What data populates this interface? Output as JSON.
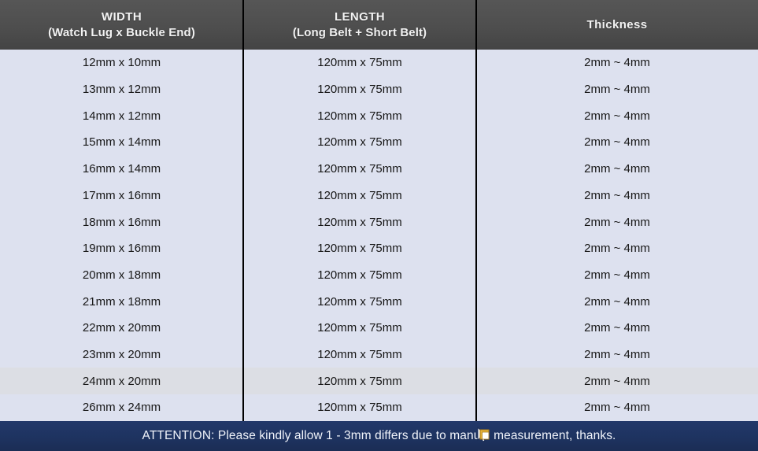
{
  "table": {
    "columns": [
      {
        "key": "width",
        "line1": "WIDTH",
        "line2": "(Watch Lug x Buckle End)"
      },
      {
        "key": "length",
        "line1": "LENGTH",
        "line2": "(Long Belt + Short Belt)"
      },
      {
        "key": "thickness",
        "line1": "Thickness",
        "line2": ""
      }
    ],
    "rows": [
      {
        "width": "12mm x 10mm",
        "length": "120mm x 75mm",
        "thickness": "2mm ~ 4mm",
        "highlighted": false
      },
      {
        "width": "13mm x 12mm",
        "length": "120mm x 75mm",
        "thickness": "2mm ~ 4mm",
        "highlighted": false
      },
      {
        "width": "14mm x 12mm",
        "length": "120mm x 75mm",
        "thickness": "2mm ~ 4mm",
        "highlighted": false
      },
      {
        "width": "15mm x 14mm",
        "length": "120mm x 75mm",
        "thickness": "2mm ~ 4mm",
        "highlighted": false
      },
      {
        "width": "16mm x 14mm",
        "length": "120mm x 75mm",
        "thickness": "2mm ~ 4mm",
        "highlighted": false
      },
      {
        "width": "17mm x 16mm",
        "length": "120mm x 75mm",
        "thickness": "2mm ~ 4mm",
        "highlighted": false
      },
      {
        "width": "18mm x 16mm",
        "length": "120mm x 75mm",
        "thickness": "2mm ~ 4mm",
        "highlighted": false
      },
      {
        "width": "19mm x 16mm",
        "length": "120mm x 75mm",
        "thickness": "2mm ~ 4mm",
        "highlighted": false
      },
      {
        "width": "20mm x 18mm",
        "length": "120mm x 75mm",
        "thickness": "2mm ~ 4mm",
        "highlighted": false
      },
      {
        "width": "21mm x 18mm",
        "length": "120mm x 75mm",
        "thickness": "2mm ~ 4mm",
        "highlighted": false
      },
      {
        "width": "22mm x 20mm",
        "length": "120mm x 75mm",
        "thickness": "2mm ~ 4mm",
        "highlighted": false
      },
      {
        "width": "23mm x 20mm",
        "length": "120mm x 75mm",
        "thickness": "2mm ~ 4mm",
        "highlighted": false
      },
      {
        "width": "24mm x 20mm",
        "length": "120mm x 75mm",
        "thickness": "2mm ~ 4mm",
        "highlighted": true
      },
      {
        "width": "26mm x 24mm",
        "length": "120mm x 75mm",
        "thickness": "2mm ~ 4mm",
        "highlighted": false
      }
    ]
  },
  "footer": {
    "notice": "ATTENTION: Please kindly allow 1 - 3mm differs due to manual measurement, thanks."
  },
  "cursor": {
    "icon": "drag-copy-cursor-icon"
  },
  "colors": {
    "header_bg": "#4e4e4e",
    "header_text": "#f2f2f2",
    "body_bg": "#dde1ef",
    "row_highlight_bg": "#dcdee4",
    "body_text": "#161616",
    "divider": "#000000",
    "footer_bg": "#1e3360",
    "footer_text": "#f0f3fa"
  }
}
